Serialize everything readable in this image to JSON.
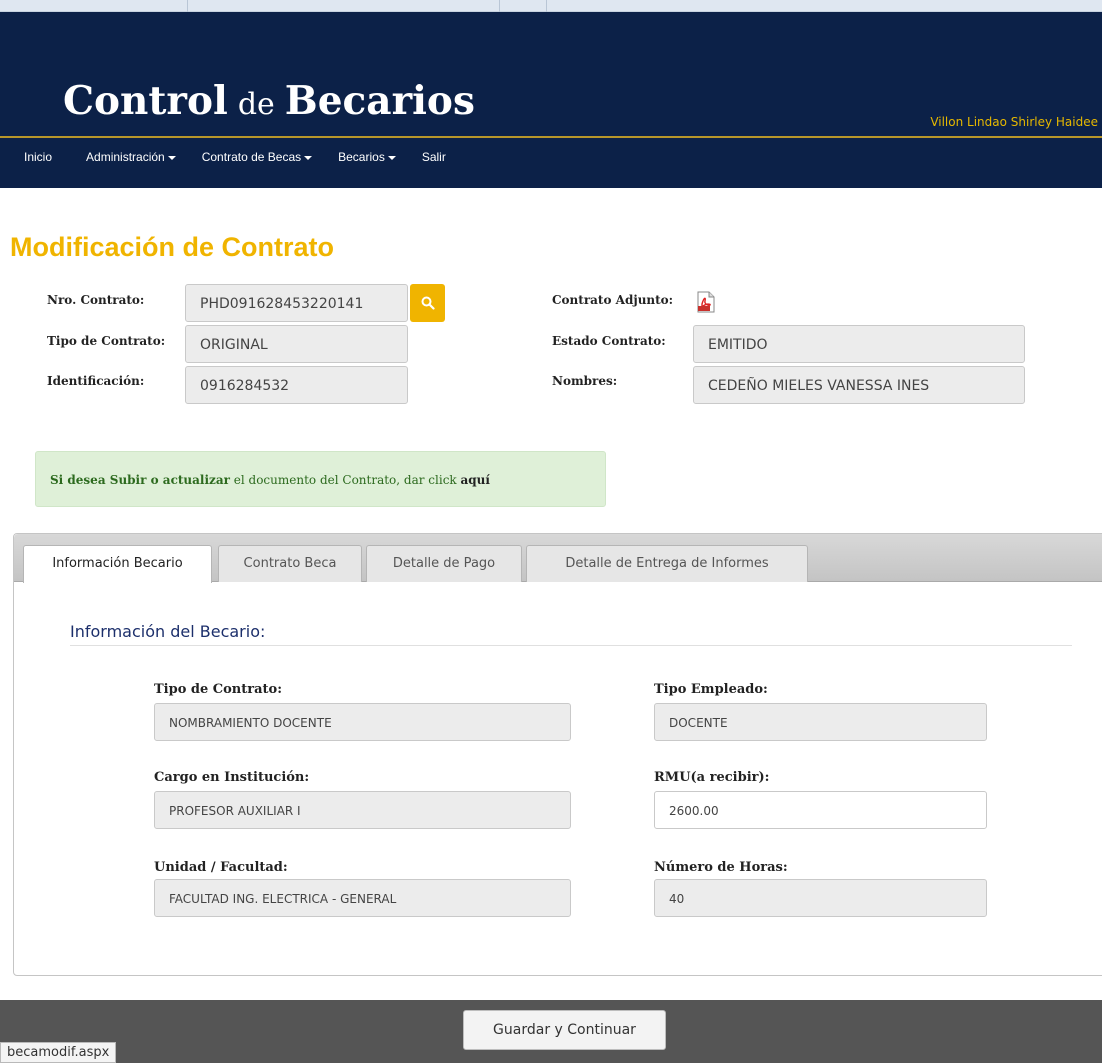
{
  "app": {
    "title_part1": "Control",
    "title_part2": "de",
    "title_part3": "Becarios",
    "user_name": "Villon Lindao Shirley Haidee"
  },
  "nav": {
    "items": [
      {
        "label": "Inicio",
        "dropdown": false
      },
      {
        "label": "Administración",
        "dropdown": true
      },
      {
        "label": "Contrato de Becas",
        "dropdown": true
      },
      {
        "label": "Becarios",
        "dropdown": true
      },
      {
        "label": "Salir",
        "dropdown": false
      }
    ]
  },
  "page": {
    "title": "Modificación de Contrato"
  },
  "contract": {
    "nro_label": "Nro. Contrato:",
    "nro_value": "PHD091628453220141",
    "tipo_label": "Tipo de Contrato:",
    "tipo_value": "ORIGINAL",
    "ident_label": "Identificación:",
    "ident_value": "0916284532",
    "adjunto_label": "Contrato Adjunto:",
    "estado_label": "Estado Contrato:",
    "estado_value": "EMITIDO",
    "nombres_label": "Nombres:",
    "nombres_value": "CEDEÑO MIELES VANESSA INES"
  },
  "alert": {
    "bold_part": "Si desea Subir o actualizar",
    "text_part": " el documento del Contrato, dar click ",
    "link_text": "aquí"
  },
  "tabs": [
    {
      "label": "Información Becario",
      "active": true
    },
    {
      "label": "Contrato Beca",
      "active": false
    },
    {
      "label": "Detalle de Pago",
      "active": false
    },
    {
      "label": "Detalle de Entrega de Informes",
      "active": false
    }
  ],
  "becario": {
    "section_title": "Información del Becario:",
    "tipo_contrato_label": "Tipo de Contrato:",
    "tipo_contrato_value": "NOMBRAMIENTO DOCENTE",
    "tipo_empleado_label": "Tipo Empleado:",
    "tipo_empleado_value": "DOCENTE",
    "cargo_label": "Cargo en Institución:",
    "cargo_value": "PROFESOR AUXILIAR I",
    "rmu_label": "RMU(a recibir):",
    "rmu_value": "2600.00",
    "unidad_label": "Unidad / Facultad:",
    "unidad_value": "FACULTAD ING. ELECTRICA - GENERAL",
    "horas_label": "Número de Horas:",
    "horas_value": "40"
  },
  "footer": {
    "save_label": "Guardar y Continuar"
  },
  "status_bar": {
    "text": "becamodif.aspx"
  },
  "colors": {
    "header_bg": "#0c2148",
    "accent_gold": "#f0b400",
    "alert_bg": "#dff0d8"
  }
}
